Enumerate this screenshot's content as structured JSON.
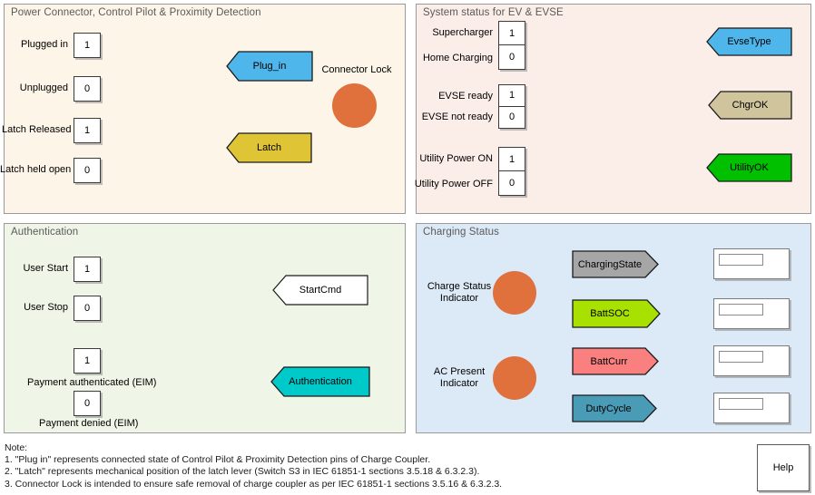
{
  "panels": {
    "power": {
      "title": "Power Connector, Control Pilot & Proximity Detection",
      "bg": "#FDF5E8"
    },
    "system": {
      "title": "System status for EV & EVSE",
      "bg": "#FBEDE8"
    },
    "auth": {
      "title": "Authentication",
      "bg": "#EFF5E7"
    },
    "charging": {
      "title": "Charging Status",
      "bg": "#DCEAF7"
    }
  },
  "power": {
    "labels": {
      "plugged_in": "Plugged in",
      "unplugged": "Unplugged",
      "latch_released": "Latch Released",
      "latch_held_open": "Latch held open",
      "connector_lock": "Connector Lock"
    },
    "values": {
      "plugged_in": "1",
      "unplugged": "0",
      "latch_released": "1",
      "latch_held_open": "0"
    },
    "signals": {
      "plug_in": "Plug_in",
      "latch": "Latch"
    },
    "colors": {
      "plug_in": "#4FB6EC",
      "latch": "#DFC536",
      "lamp": "#E0703C"
    }
  },
  "system": {
    "labels": {
      "supercharger": "Supercharger",
      "home_charging": "Home Charging",
      "evse_ready": "EVSE ready",
      "evse_not_ready": "EVSE not ready",
      "utility_power_on": "Utility Power ON",
      "utility_power_off": "Utility Power OFF"
    },
    "values": {
      "supercharger": "1",
      "home_charging": "0",
      "evse_ready": "1",
      "evse_not_ready": "0",
      "utility_power_on": "1",
      "utility_power_off": "0"
    },
    "signals": {
      "evse_type": "EvseType",
      "chgr_ok": "ChgrOK",
      "utility_ok": "UtilityOK"
    },
    "colors": {
      "evse_type": "#4FB6EC",
      "chgr_ok": "#CFC49C",
      "utility_ok": "#00C000"
    }
  },
  "auth": {
    "labels": {
      "user_start": "User Start",
      "user_stop": "User Stop",
      "payment_authenticated": "Payment authenticated (EIM)",
      "payment_denied": "Payment denied (EIM)"
    },
    "values": {
      "user_start": "1",
      "user_stop": "0",
      "payment_authenticated": "1",
      "payment_denied": "0"
    },
    "signals": {
      "start_cmd": "StartCmd",
      "authentication": "Authentication"
    },
    "colors": {
      "start_cmd": "#FFFFFF",
      "authentication": "#00C9C9"
    }
  },
  "charging": {
    "labels": {
      "charge_status_indicator_line1": "Charge Status",
      "charge_status_indicator_line2": "Indicator",
      "ac_present_indicator_line1": "AC Present",
      "ac_present_indicator_line2": "Indicator"
    },
    "signals": {
      "charging_state": "ChargingState",
      "batt_soc": "BattSOC",
      "batt_curr": "BattCurr",
      "duty_cycle": "DutyCycle"
    },
    "display_values": {
      "charging_state": "",
      "batt_soc": "",
      "batt_curr": "",
      "duty_cycle": ""
    },
    "colors": {
      "charging_state": "#A6A6A6",
      "batt_soc": "#A8E000",
      "batt_curr": "#F9807F",
      "duty_cycle": "#4A9BB5",
      "lamp": "#E0703C"
    }
  },
  "notes": {
    "heading": "Note:",
    "line1": "1. \"Plug in\" represents connected state of Control Pilot & Proximity Detection pins of Charge Coupler.",
    "line2": "2. \"Latch\" represents mechanical position of the latch lever (Switch S3 in IEC 61851-1 sections 3.5.18 & 6.3.2.3).",
    "line3": "3. Connector Lock is intended to ensure safe removal of charge coupler as per IEC 61851-1 sections 3.5.16 & 6.3.2.3."
  },
  "help": {
    "label": "Help"
  }
}
